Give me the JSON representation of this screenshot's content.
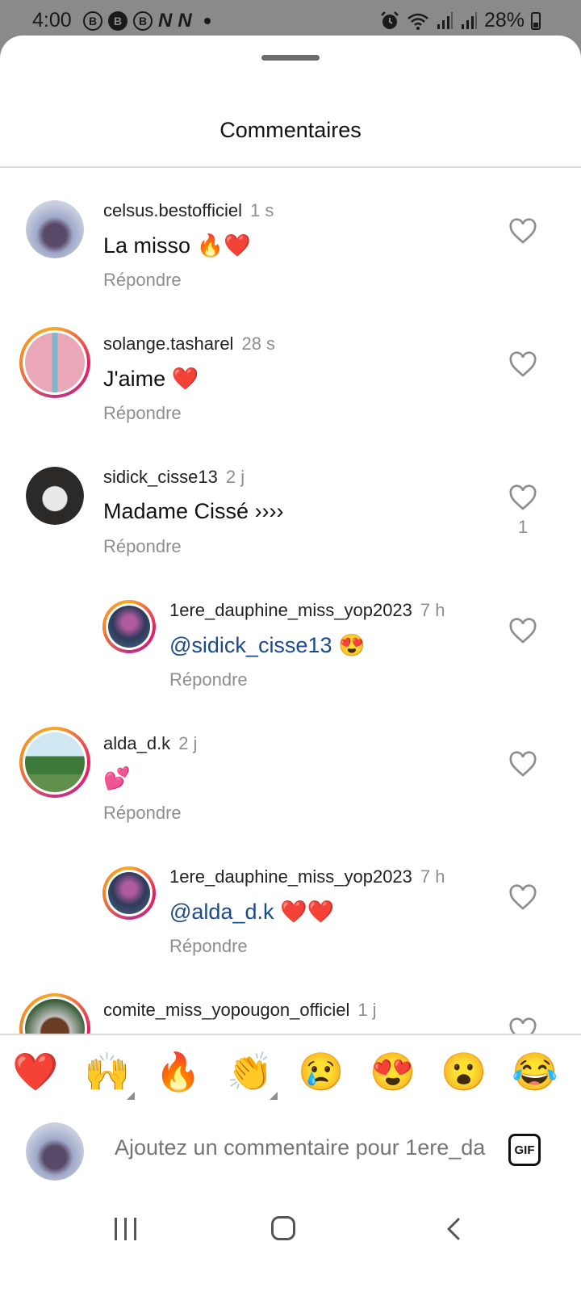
{
  "status_bar": {
    "time": "4:00",
    "notif_icons": [
      "B",
      "B",
      "B"
    ],
    "n_icons": [
      "N",
      "N"
    ],
    "battery": "28%",
    "icon_names": [
      "alarm-icon",
      "wifi-icon",
      "signal-icon",
      "signal-icon",
      "battery-icon"
    ]
  },
  "sheet": {
    "title": "Commentaires"
  },
  "comments": [
    {
      "username": "celsus.bestofficiel",
      "time": "1 s",
      "text": "La misso 🔥❤️",
      "reply": "Répondre",
      "likes": ""
    },
    {
      "username": "solange.tasharel",
      "time": "28 s",
      "text": "J'aime ❤️",
      "reply": "Répondre",
      "likes": ""
    },
    {
      "username": "sidick_cisse13",
      "time": "2 j",
      "text": "Madame Cissé ››››",
      "reply": "Répondre",
      "likes": "1"
    },
    {
      "username": "1ere_dauphine_miss_yop2023",
      "time": "7 h",
      "mention": "@sidick_cisse13",
      "text": " 😍",
      "reply": "Répondre",
      "likes": ""
    },
    {
      "username": "alda_d.k",
      "time": "2 j",
      "text": "💕",
      "reply": "Répondre",
      "likes": ""
    },
    {
      "username": "1ere_dauphine_miss_yop2023",
      "time": "7 h",
      "mention": "@alda_d.k",
      "text": " ❤️❤️",
      "reply": "Répondre",
      "likes": ""
    },
    {
      "username": "comite_miss_yopougon_officiel",
      "time": "1 j",
      "text": "❤️",
      "reply": "",
      "likes": ""
    }
  ],
  "emoji_bar": [
    "❤️",
    "🙌",
    "🔥",
    "👏",
    "😢",
    "😍",
    "😮",
    "😂"
  ],
  "compose": {
    "placeholder": "Ajoutez un commentaire pour 1ere_dauphine_miss_yop2023",
    "gif_label": "GIF"
  },
  "colors": {
    "mention": "#1a4b8c",
    "secondary_text": "#8e8e8e",
    "divider": "#dbdbdb"
  }
}
